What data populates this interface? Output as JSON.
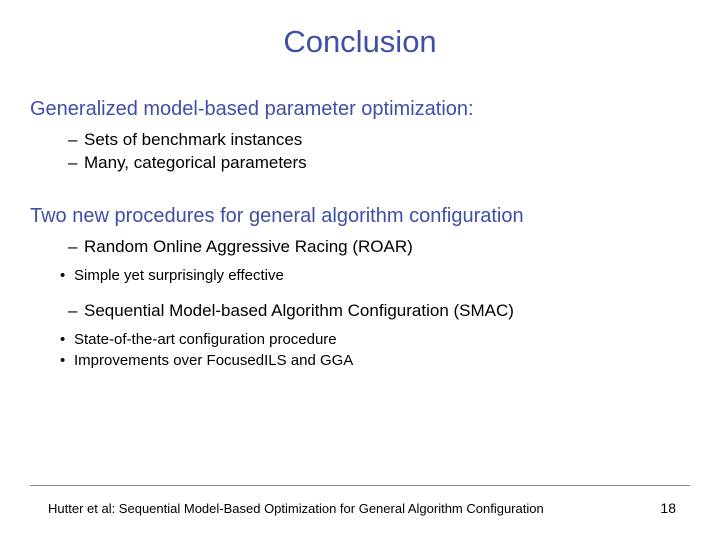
{
  "title": "Conclusion",
  "section1": {
    "heading": "Generalized model-based parameter optimization:",
    "items": [
      "Sets of benchmark instances",
      "Many, categorical parameters"
    ]
  },
  "section2": {
    "heading": "Two new procedures for general algorithm configuration",
    "blocks": [
      {
        "title": "Random Online Aggressive Racing (ROAR)",
        "sub": [
          "Simple yet surprisingly effective"
        ]
      },
      {
        "title": "Sequential Model-based Algorithm Configuration (SMAC)",
        "sub": [
          "State-of-the-art configuration procedure",
          "Improvements over FocusedILS and GGA"
        ]
      }
    ]
  },
  "footer": {
    "citation": "Hutter et al: Sequential Model-Based Optimization for General Algorithm Configuration",
    "page": "18"
  }
}
